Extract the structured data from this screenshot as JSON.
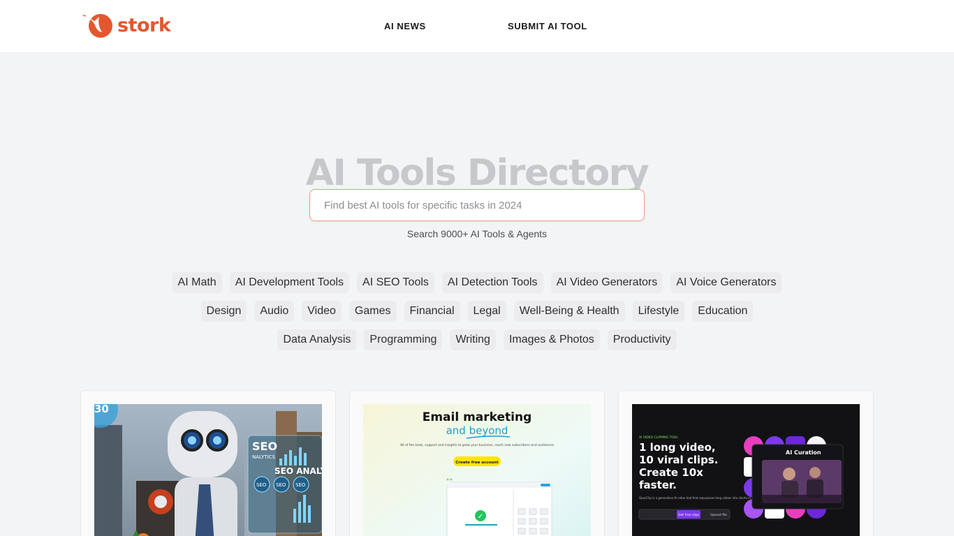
{
  "brand": {
    "name": "stork",
    "color": "#e4572e"
  },
  "nav": [
    {
      "label": "AI NEWS"
    },
    {
      "label": "SUBMIT AI TOOL"
    }
  ],
  "hero": {
    "title": "AI Tools Directory",
    "search_placeholder": "Find best AI tools for specific tasks in 2024",
    "search_value": "",
    "subtitle": "Search 9000+ AI Tools & Agents"
  },
  "categories": {
    "row1": [
      "AI Math",
      "AI Development Tools",
      "AI SEO Tools",
      "AI Detection Tools",
      "AI Video Generators",
      "AI Voice Generators"
    ],
    "row2": [
      "Design",
      "Audio",
      "Video",
      "Games",
      "Financial",
      "Legal",
      "Well-Being & Health",
      "Lifestyle",
      "Education"
    ],
    "row3": [
      "Data Analysis",
      "Programming",
      "Writing",
      "Images & Photos",
      "Productivity"
    ]
  },
  "cards": [
    {
      "panel_title": "SEO",
      "panel_subtitle": "NALYTICS",
      "panel_title2": "SEO ANALYTIC",
      "corner_num": "30",
      "badges": [
        "SEO",
        "SEO",
        "SEO"
      ]
    },
    {
      "headline1": "Email marketing",
      "headline2": "and beyond",
      "body": "All of the tools, support and insights to grow your business, reach new subscribers and audiences",
      "cta": "Create free account",
      "check": "✓"
    },
    {
      "eyebrow": "AI VIDEO CLIPPING TOOL",
      "headline": [
        "1 long video,",
        "10 viral clips.",
        "Create 10x",
        "faster."
      ],
      "body": "OpusClip is a generative AI video tool that repurposes long videos into shorts in one click. Powered by OpusAI",
      "cta": "Get free clips",
      "upload": "Upload file",
      "overlay_label": "AI Curation",
      "accent": "#7c3aed"
    }
  ]
}
